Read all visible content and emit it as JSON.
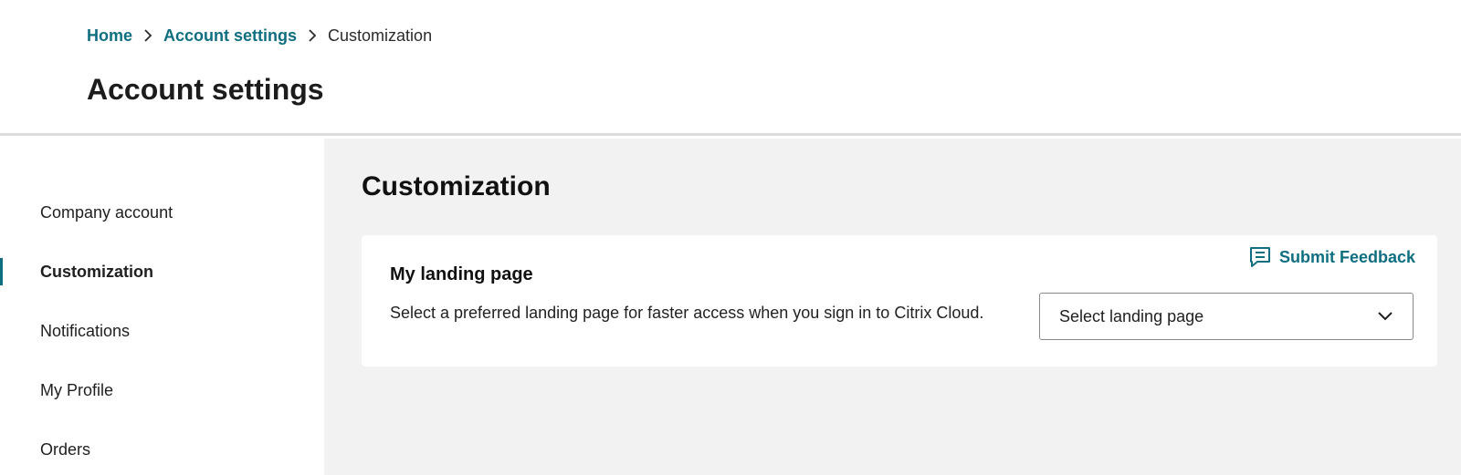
{
  "breadcrumb": {
    "home": "Home",
    "account_settings": "Account settings",
    "current": "Customization"
  },
  "header": {
    "title": "Account settings"
  },
  "sidebar": {
    "items": [
      {
        "label": "Company account",
        "active": false
      },
      {
        "label": "Customization",
        "active": true
      },
      {
        "label": "Notifications",
        "active": false
      },
      {
        "label": "My Profile",
        "active": false
      },
      {
        "label": "Orders",
        "active": false
      }
    ]
  },
  "main": {
    "title": "Customization",
    "card": {
      "feedback_label": "Submit Feedback",
      "feedback_icon": "feedback-icon",
      "title": "My landing page",
      "description": "Select a preferred landing page for faster access when you sign in to Citrix Cloud.",
      "select_value": "Select landing page",
      "select_icon": "chevron-down-icon"
    }
  },
  "colors": {
    "accent": "#0f6e80",
    "main_bg": "#f2f2f2",
    "divider": "#dcdcdc"
  }
}
